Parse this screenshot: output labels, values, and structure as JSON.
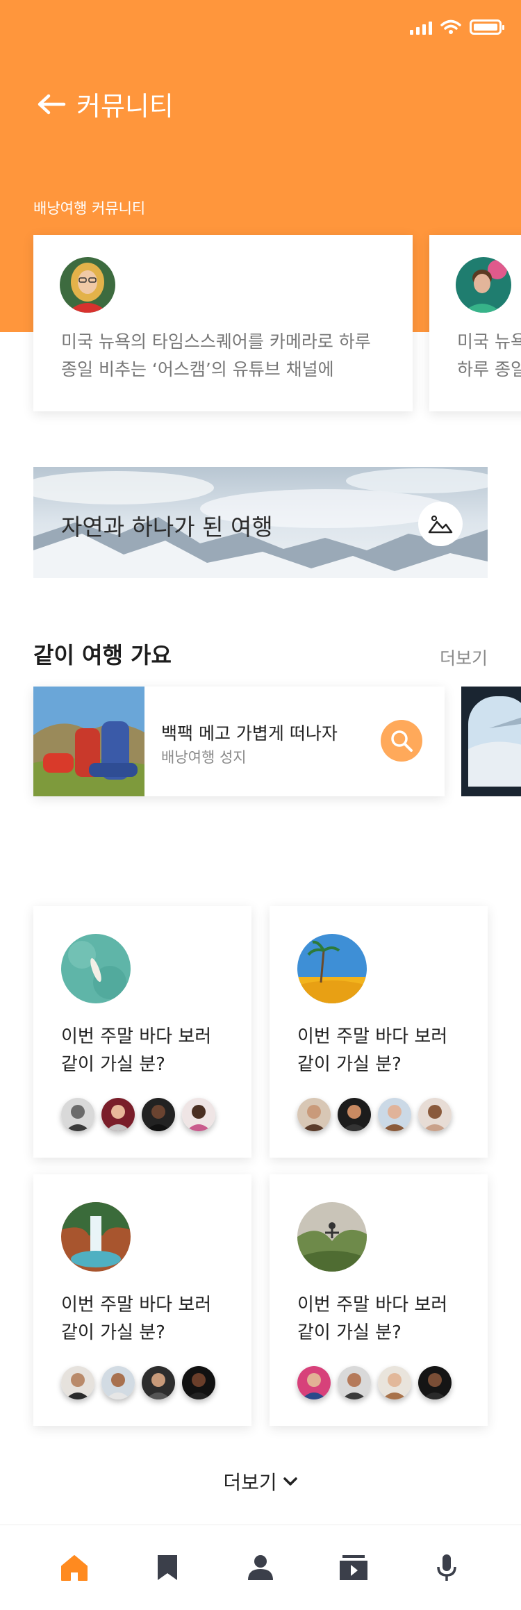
{
  "header": {
    "title": "커뮤니티",
    "section_label": "배낭여행 커뮤니티"
  },
  "community_cards": [
    {
      "text": "미국 뉴욕의 타임스스퀘어를 카메라로 하루 종일 비추는 ‘어스캠’의 유튜브 채널에"
    },
    {
      "text": "미국 뉴욕의 타임스스퀘어를 카메라로 하루 종일 비추는"
    }
  ],
  "banner": {
    "title": "자연과 하나가 된 여행",
    "icon": "image-icon"
  },
  "together": {
    "title": "같이 여행 가요",
    "more_label": "더보기",
    "card": {
      "title": "백팩 메고 가볍게 떠나자",
      "subtitle": "배낭여행 성지",
      "icon": "search-icon"
    }
  },
  "grid": [
    {
      "text_line1": "이번 주말 바다 보러",
      "text_line2": "같이 가실 분?"
    },
    {
      "text_line1": "이번 주말 바다 보러",
      "text_line2": "같이 가실 분?"
    },
    {
      "text_line1": "이번 주말 바다 보러",
      "text_line2": "같이 가실 분?"
    },
    {
      "text_line1": "이번 주말 바다 보러",
      "text_line2": "같이 가실 분?"
    }
  ],
  "more_button": {
    "label": "더보기"
  },
  "nav": [
    "home-icon",
    "bookmark-icon",
    "person-icon",
    "video-library-icon",
    "mic-icon"
  ],
  "colors": {
    "accent": "#FF963C",
    "button": "#FFA95A",
    "nav_active": "#FF8A1F",
    "nav_inactive": "#3b3f4a"
  }
}
